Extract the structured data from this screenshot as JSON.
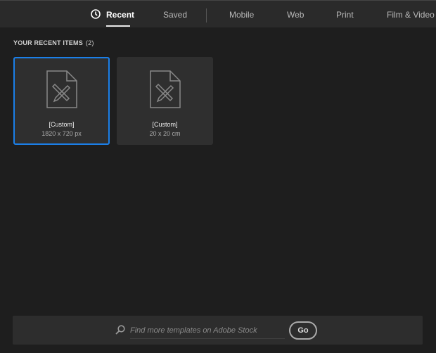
{
  "tabs": [
    {
      "label": "Recent",
      "active": true,
      "icon": "clock-icon"
    },
    {
      "label": "Saved"
    },
    {
      "label": "Mobile"
    },
    {
      "label": "Web"
    },
    {
      "label": "Print"
    },
    {
      "label": "Film & Video"
    }
  ],
  "recent": {
    "heading": "YOUR RECENT ITEMS",
    "count": "(2)",
    "items": [
      {
        "name": "[Custom]",
        "size": "1820 x 720 px",
        "selected": true,
        "icon": "document-custom-icon"
      },
      {
        "name": "[Custom]",
        "size": "20 x 20 cm",
        "selected": false,
        "icon": "document-custom-icon"
      }
    ]
  },
  "search": {
    "placeholder": "Find more templates on Adobe Stock",
    "go_label": "Go",
    "icon": "search-icon"
  },
  "colors": {
    "accent": "#1b7fe8",
    "background": "#1e1e1e",
    "header": "#2a2a2a"
  }
}
